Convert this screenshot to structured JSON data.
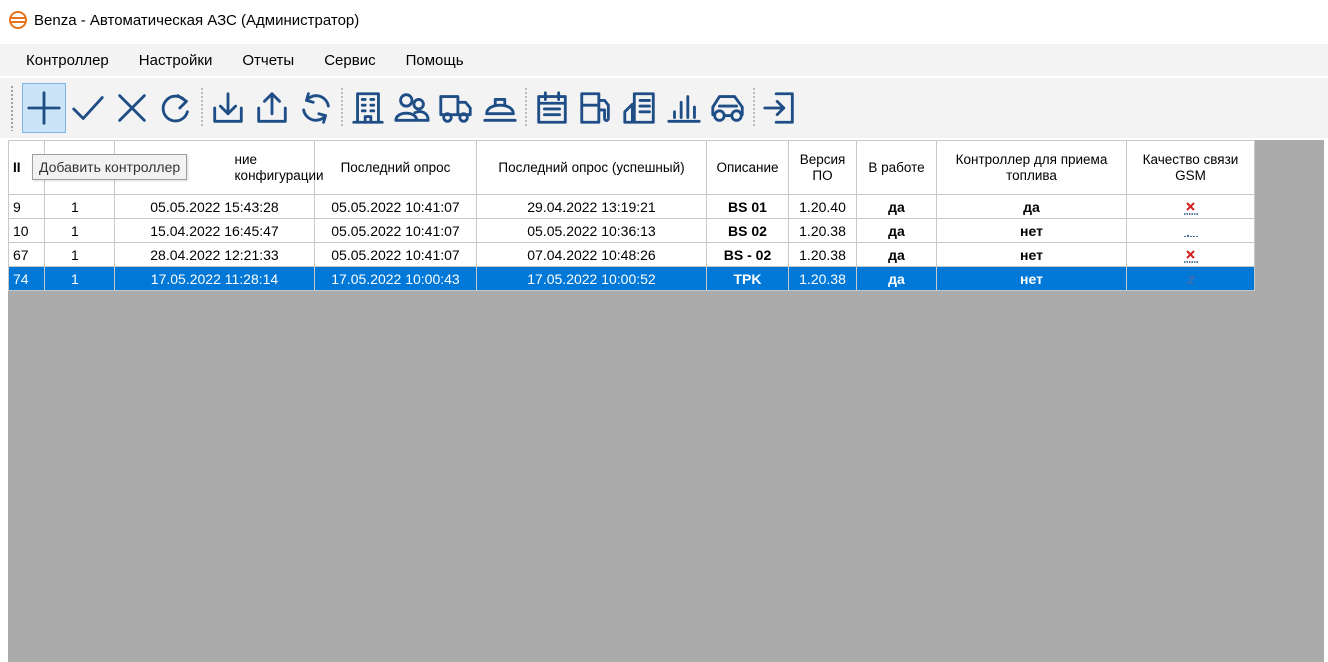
{
  "window": {
    "title": "Benza - Автоматическая АЗС (Администратор)"
  },
  "menu": [
    "Контроллер",
    "Настройки",
    "Отчеты",
    "Сервис",
    "Помощь"
  ],
  "toolbar": {
    "buttons": [
      {
        "icon": "plus-icon"
      },
      {
        "icon": "check-icon"
      },
      {
        "icon": "cross-icon"
      },
      {
        "icon": "refresh-icon"
      },
      {
        "icon": "download-icon"
      },
      {
        "icon": "upload-icon"
      },
      {
        "icon": "sync-icon"
      },
      {
        "icon": "building-icon"
      },
      {
        "icon": "users-icon"
      },
      {
        "icon": "truck-icon"
      },
      {
        "icon": "tank-icon"
      },
      {
        "icon": "calendar-icon"
      },
      {
        "icon": "fuel-icon"
      },
      {
        "icon": "card-icon"
      },
      {
        "icon": "chart-icon"
      },
      {
        "icon": "car-icon"
      },
      {
        "icon": "exit-icon"
      }
    ]
  },
  "tooltip": "Добавить контроллер",
  "grid": {
    "headers": [
      "II",
      "",
      "ние конфигурации",
      "Последний опрос",
      "Последний опрос (успешный)",
      "Описание",
      "Версия ПО",
      "В работе",
      "Контроллер для приема топлива",
      "Качество связи GSM"
    ],
    "rows": [
      {
        "id": "9",
        "n": "1",
        "config": "05.05.2022 15:43:28",
        "last": "05.05.2022 10:41:07",
        "success": "29.04.2022 13:19:21",
        "desc": "BS 01",
        "ver": "1.20.40",
        "work": "да",
        "fuel": "да",
        "gsm": "no-signal"
      },
      {
        "id": "10",
        "n": "1",
        "config": "15.04.2022 16:45:47",
        "last": "05.05.2022 10:41:07",
        "success": "05.05.2022 10:36:13",
        "desc": "BS 02",
        "ver": "1.20.38",
        "work": "да",
        "fuel": "нет",
        "gsm": "weak-signal"
      },
      {
        "id": "67",
        "n": "1",
        "config": "28.04.2022 12:21:33",
        "last": "05.05.2022 10:41:07",
        "success": "07.04.2022 10:48:26",
        "desc": "BS - 02",
        "ver": "1.20.38",
        "work": "да",
        "fuel": "нет",
        "gsm": "no-signal"
      },
      {
        "id": "74",
        "n": "1",
        "config": "17.05.2022 11:28:14",
        "last": "17.05.2022 10:00:43",
        "success": "17.05.2022 10:00:52",
        "desc": "TPK",
        "ver": "1.20.38",
        "work": "да",
        "fuel": "нет",
        "gsm": "unknown-signal"
      }
    ]
  },
  "colors": {
    "icon": "#1f4e86",
    "selection": "#0078d7",
    "grid_bg": "#ababab"
  }
}
